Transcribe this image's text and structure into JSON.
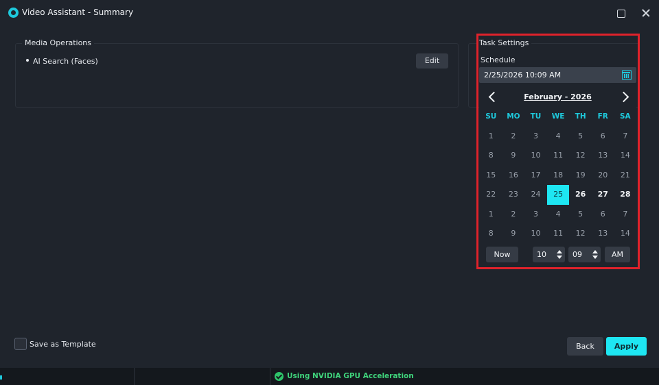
{
  "window": {
    "title": "Video Assistant - Summary",
    "icons": {
      "app": "app-logo-icon",
      "maximize": "maximize-icon",
      "close": "close-icon"
    }
  },
  "media_operations": {
    "title": "Media Operations",
    "items": [
      {
        "label": "AI Search (Faces)"
      }
    ],
    "edit_label": "Edit"
  },
  "task_settings": {
    "title": "Task Settings",
    "schedule_label": "Schedule",
    "schedule_value": "2/25/2026 10:09 AM",
    "calendar_icon": "calendar-icon"
  },
  "calendar": {
    "month_label": "February - 2026",
    "weekdays": [
      "SU",
      "MO",
      "TU",
      "WE",
      "TH",
      "FR",
      "SA"
    ],
    "days": [
      "1",
      "2",
      "3",
      "4",
      "5",
      "6",
      "7",
      "8",
      "9",
      "10",
      "11",
      "12",
      "13",
      "14",
      "15",
      "16",
      "17",
      "18",
      "19",
      "20",
      "21",
      "22",
      "23",
      "24",
      "25",
      "26",
      "27",
      "28",
      "1",
      "2",
      "3",
      "4",
      "5",
      "6",
      "7",
      "8",
      "9",
      "10",
      "11",
      "12",
      "13",
      "14"
    ],
    "current_month_days": [
      "25",
      "26",
      "27",
      "28"
    ],
    "selected_day": "25",
    "now_label": "Now",
    "hour": "10",
    "minute": "09",
    "ampm": "AM",
    "accent": "#1ee6f2"
  },
  "footer": {
    "template_label": "Save as Template",
    "template_checked": false,
    "back_label": "Back",
    "apply_label": "Apply"
  },
  "status": {
    "gpu_label": "Using NVIDIA GPU Acceleration",
    "gpu_color": "#3fd27b"
  }
}
